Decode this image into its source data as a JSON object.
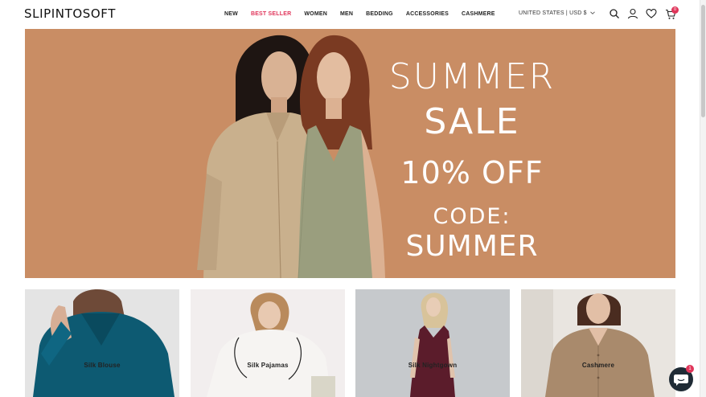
{
  "brand": {
    "logo": "SLIPINTOSOFT"
  },
  "nav": {
    "items": [
      {
        "label": "NEW"
      },
      {
        "label": "BEST SELLER"
      },
      {
        "label": "WOMEN"
      },
      {
        "label": "MEN"
      },
      {
        "label": "BEDDING"
      },
      {
        "label": "ACCESSORIES"
      },
      {
        "label": "CASHMERE"
      }
    ]
  },
  "header": {
    "locale": "UNITED STATES | USD $",
    "cart_count": "0",
    "icons": [
      "search-icon",
      "account-icon",
      "wishlist-icon",
      "cart-icon"
    ]
  },
  "hero": {
    "line1": "SUMMER",
    "line2": "SALE",
    "line3": "10% OFF",
    "line4": "CODE:",
    "line5": "SUMMER",
    "bg_color": "#c98d64"
  },
  "categories": [
    {
      "label": "Silk Blouse"
    },
    {
      "label": "Silk Pajamas"
    },
    {
      "label": "Silk Nightgown"
    },
    {
      "label": "Cashmere"
    }
  ],
  "chat": {
    "badge": "1"
  },
  "colors": {
    "accent": "#e0355a",
    "chat": "#1f2b35"
  }
}
